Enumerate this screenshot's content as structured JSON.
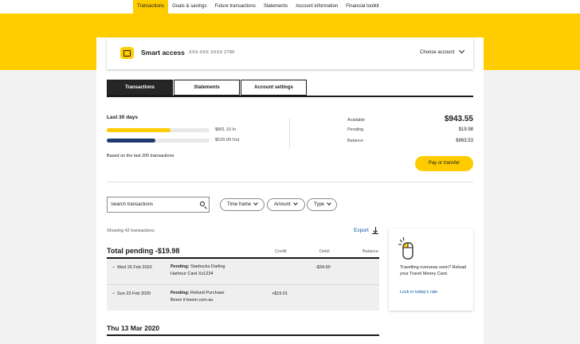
{
  "top_nav": {
    "tabs": [
      {
        "label": "Transactions",
        "active": true
      },
      {
        "label": "Goals & savings",
        "active": false
      },
      {
        "label": "Future transactions",
        "active": false
      },
      {
        "label": "Statements",
        "active": false
      },
      {
        "label": "Account information",
        "active": false
      },
      {
        "label": "Financial toolkit",
        "active": false
      }
    ]
  },
  "account": {
    "name": "Smart access",
    "number": "XXX-XXX  XXXX 2789",
    "choose_label": "Choose account"
  },
  "sub_tabs": [
    {
      "label": "Transactions",
      "active": true
    },
    {
      "label": "Statements",
      "active": false
    },
    {
      "label": "Account settings",
      "active": false
    }
  ],
  "summary": {
    "period": "Last 30 days",
    "money_in": {
      "label": "$801.10 In",
      "fraction": 0.62
    },
    "money_out": {
      "label": "$529.00 Out",
      "fraction": 0.47
    },
    "based_on": "Based on the last 200 transactions",
    "available_label": "Available",
    "available_value": "$943.55",
    "pending_label": "Pending",
    "pending_value": "$19.98",
    "balance_label": "Balance",
    "balance_value": "$963.53",
    "pay_button": "Pay or transfer"
  },
  "filters": {
    "search_placeholder": "Search transactions",
    "time_frame": "Time frame",
    "amount": "Amount",
    "type": "Type"
  },
  "list": {
    "showing": "Showing 42 transactions",
    "export_label": "Export",
    "pending_heading": "Total pending  -$19.98",
    "col_credit": "Credit",
    "col_debit": "Debit",
    "col_balance": "Balance",
    "rows": [
      {
        "arrow": "→",
        "date": "Wed 26 Feb 2020",
        "prefix": "Pending:",
        "desc1": " Starbucks Darling",
        "desc2": "Harbour Card Xx1234",
        "credit": "",
        "debit": "-$34.90"
      },
      {
        "arrow": "→",
        "date": "Sun 23 Feb 2020",
        "prefix": "Pending:",
        "desc1": " Refund Purchase",
        "desc2": "Beem it beem.com.au",
        "credit": "+$15.01",
        "debit": ""
      }
    ],
    "date_heading": "Thu 13 Mar 2020"
  },
  "promo": {
    "text": "Travelling overseas soon? Reload your Travel Money Card.",
    "link": "Lock in today's rate"
  },
  "colors": {
    "brand_yellow": "#ffcc00",
    "money_out_bar": "#1f3a6e",
    "link_blue": "#0a58a8"
  }
}
